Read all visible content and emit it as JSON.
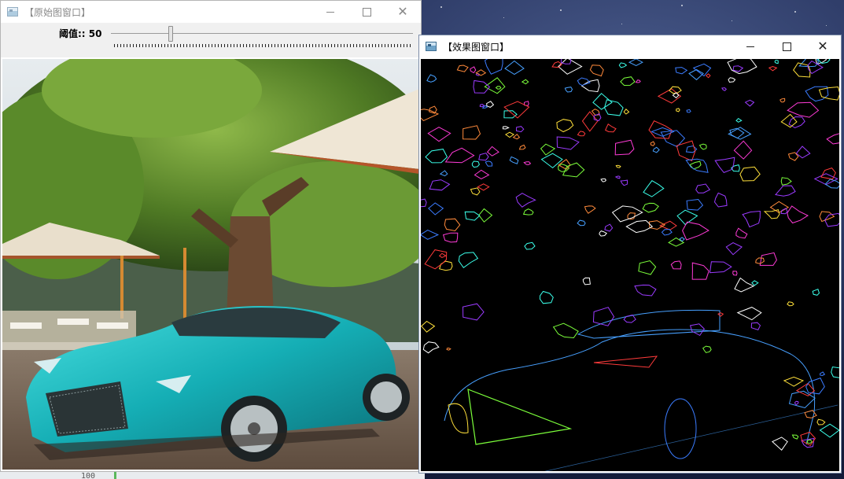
{
  "original_window": {
    "title": "【原始图窗口】",
    "trackbar": {
      "label": "阈值:: 50",
      "value": 50,
      "max": 255
    }
  },
  "effect_window": {
    "title": "【效果图窗口】"
  },
  "behind": {
    "number": "100"
  },
  "colors": {
    "car": "#1db5b8",
    "edge_palette": [
      "#ff3b3b",
      "#7cff3b",
      "#3b7cff",
      "#ff3bd7",
      "#ffffff",
      "#ffe03b",
      "#3bffea",
      "#9b3bff",
      "#ff8a3b",
      "#47a0ff"
    ]
  }
}
